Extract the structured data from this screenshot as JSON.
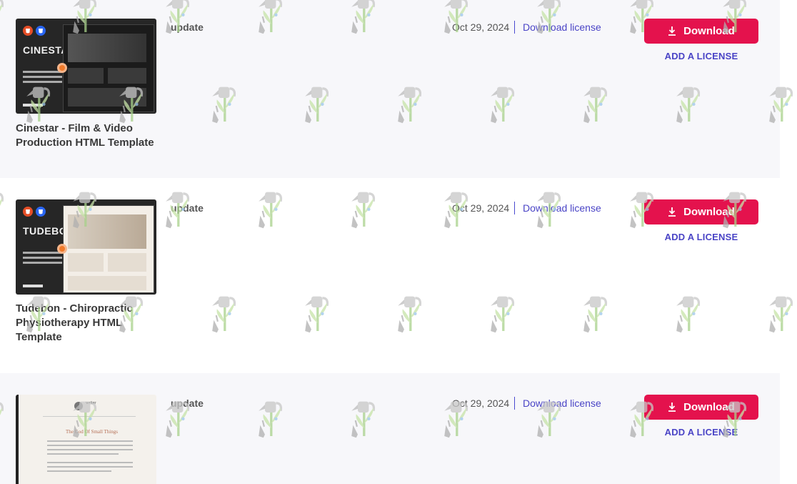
{
  "items": [
    {
      "title": "Cinestar - Film & Video Production HTML Template",
      "thumb_brand": "CINESTAR",
      "tag": "update",
      "date": "Oct 29, 2024",
      "license_link": "Download license",
      "download_label": "Download",
      "add_license_label": "ADD A LICENSE"
    },
    {
      "title": "Tudebon - Chiropractic Physiotherapy HTML Template",
      "thumb_brand": "TUDEBON",
      "tag": "update",
      "date": "Oct 29, 2024",
      "license_link": "Download license",
      "download_label": "Download",
      "add_license_label": "ADD A LICENSE"
    },
    {
      "title": "",
      "thumb_name": "writer",
      "thumb_heading": "The God Of Small Things",
      "tag": "update",
      "date": "Oct 29, 2024",
      "license_link": "Download license",
      "download_label": "Download",
      "add_license_label": "ADD A LICENSE"
    }
  ],
  "colors": {
    "accent_button": "#e4124d",
    "link": "#4a44c6",
    "row_shade": "#f7f7fa"
  },
  "icons": {
    "download": "download-arrow-icon",
    "watermark": "watering-can-plant-icon"
  }
}
